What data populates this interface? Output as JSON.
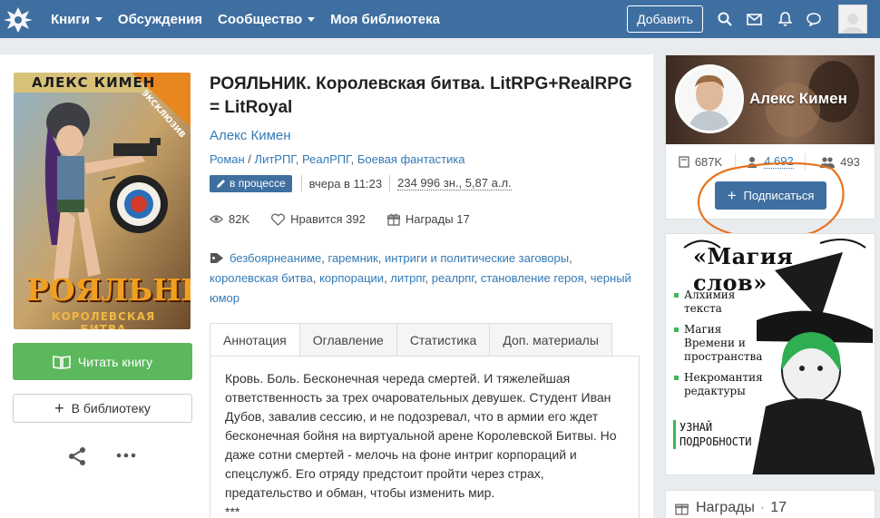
{
  "nav": {
    "items": [
      {
        "label": "Книги",
        "dropdown": true
      },
      {
        "label": "Обсуждения",
        "dropdown": false
      },
      {
        "label": "Сообщество",
        "dropdown": true
      },
      {
        "label": "Моя библиотека",
        "dropdown": false
      }
    ],
    "add_button": "Добавить",
    "icons": [
      "search-icon",
      "mail-icon",
      "bell-icon",
      "chat-icon"
    ],
    "bar_color": "#3f6fa0"
  },
  "book": {
    "title": "РОЯЛЬНИК. Королевская битва. LitRPG+RealRPG = LitRoyal",
    "author": "Алекс Кимен",
    "genres": [
      "Роман",
      "ЛитРПГ",
      "РеалРПГ",
      "Боевая фантастика"
    ],
    "status": "в процессе",
    "updated": "вчера в 11:23",
    "size": "234 996 зн., 5,87 а.л.",
    "views": "82K",
    "likes_label": "Нравится",
    "likes": "392",
    "awards_label": "Награды",
    "awards": "17",
    "tags": [
      "безбоярнеаниме",
      "гаремник",
      "интриги и политические заговоры",
      "королевская битва",
      "корпорации",
      "литрпг",
      "реалрпг",
      "становление героя",
      "черный юмор"
    ],
    "cover": {
      "author_text": "АЛЕКС КИМЕН",
      "badge": "ЭКСКЛЮЗИВ",
      "title_text": "РОЯЛЬНИК",
      "subtitle_text": "КОРОЛЕВСКАЯ БИТВА"
    },
    "read_button": "Читать книгу",
    "library_button": "В библиотеку"
  },
  "tabs": [
    {
      "label": "Аннотация",
      "active": true
    },
    {
      "label": "Оглавление",
      "active": false
    },
    {
      "label": "Статистика",
      "active": false
    },
    {
      "label": "Доп. материалы",
      "active": false
    }
  ],
  "annotation": "Кровь. Боль. Бесконечная череда смертей. И тяжелейшая ответственность за трех очаровательных девушек. Студент Иван Дубов, завалив сессию, и не подозревал, что в армии его ждет бесконечная бойня на виртуальной арене Королевской Битвы. Но даже сотни смертей - мелочь на фоне интриг корпораций и спецслужб. Его отряду предстоит пройти через страх, предательство и обман, чтобы изменить мир.",
  "annotation_tail": "***",
  "author_card": {
    "name": "Алекс Кимен",
    "stats": {
      "books": "687K",
      "followers": "4 692",
      "friends": "493"
    },
    "subscribe": "Подписаться",
    "highlight_color": "#e8731f"
  },
  "ad": {
    "title": "«Магия слов»",
    "items": [
      "Алхимия текста",
      "Магия Времени и пространства",
      "Некромантия редактуры"
    ],
    "cta": "УЗНАЙ ПОДРОБНОСТИ",
    "accent": "#3bb85a"
  },
  "awards_card": {
    "label": "Награды",
    "separator": "·",
    "count": "17"
  }
}
